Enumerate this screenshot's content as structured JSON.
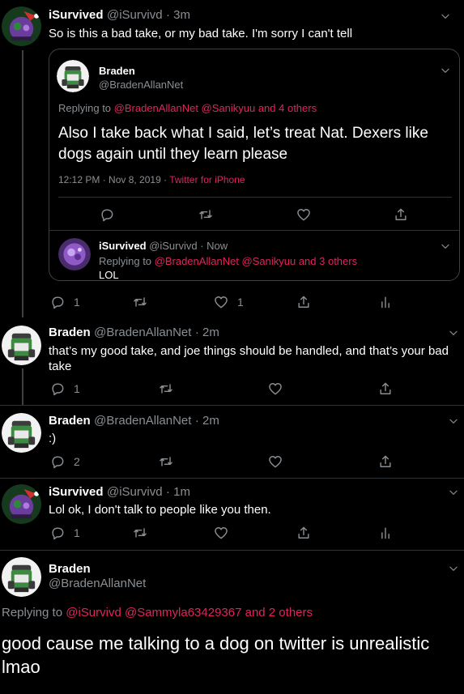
{
  "tweets": [
    {
      "name": "iSurvived",
      "handle": "@iSurvivd",
      "time": "· 3m",
      "text": "So is this a bad take, or my bad take. I'm sorry I can't tell",
      "reply_count": "1",
      "like_count": "1"
    },
    {
      "name": "Braden",
      "handle": "@BradenAllanNet",
      "time": "· 2m",
      "text": "that’s my good take, and joe things should be handled, and that’s your bad take",
      "reply_count": "1"
    },
    {
      "name": "Braden",
      "handle": "@BradenAllanNet",
      "time": "· 2m",
      "text": ":)",
      "reply_count": "2"
    },
    {
      "name": "iSurvived",
      "handle": "@iSurvivd",
      "time": "· 1m",
      "text": "Lol ok, I don't talk to people like you then.",
      "reply_count": "1"
    }
  ],
  "quoted": {
    "name": "Braden",
    "handle": "@BradenAllanNet",
    "replying_prefix": "Replying to",
    "replying_targets": "@BradenAllanNet @Sanikyuu and 4 others",
    "text": "Also I take back what I said, let’s treat Nat. Dexers like dogs again until they learn please",
    "meta_time": "12:12 PM · Nov 8, 2019 ·",
    "meta_source": "Twitter for iPhone"
  },
  "nested_reply": {
    "name": "iSurvived",
    "handle": "@iSurvivd",
    "time": "· Now",
    "replying_prefix": "Replying to",
    "replying_targets": "@BradenAllanNet @Sanikyuu and 3 others",
    "text": "LOL"
  },
  "main_tweet": {
    "name": "Braden",
    "handle": "@BradenAllanNet",
    "replying_prefix": "Replying to",
    "replying_targets": "@iSurvivd @Sammyla63429367 and 2 others",
    "text": "good cause me talking to a dog on twitter is unrealistic lmao"
  },
  "colors": {
    "background": "#000000",
    "link": "#e0245e",
    "muted": "#8a8f94",
    "border": "#3d4145"
  },
  "icons": [
    "reply-icon",
    "retweet-icon",
    "like-icon",
    "share-icon",
    "analytics-icon",
    "chevron-down-icon"
  ]
}
